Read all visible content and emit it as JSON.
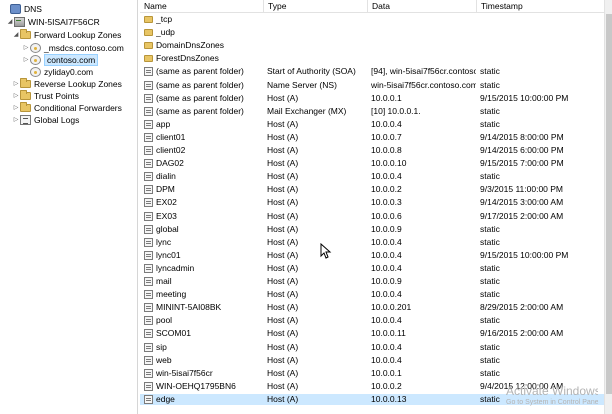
{
  "tree": {
    "items": [
      {
        "label": "DNS",
        "icon": "dns-icon",
        "expander": ""
      },
      {
        "label": "WIN-5ISAI7F56CR",
        "icon": "server-icon",
        "expander": "◢"
      },
      {
        "label": "Forward Lookup Zones",
        "icon": "folder-icon",
        "expander": "◢"
      },
      {
        "label": "_msdcs.contoso.com",
        "icon": "zone-icon",
        "expander": "▷"
      },
      {
        "label": "contoso.com",
        "icon": "zone-icon",
        "expander": "▷",
        "selected": true
      },
      {
        "label": "zyliday0.com",
        "icon": "zone-icon",
        "expander": ""
      },
      {
        "label": "Reverse Lookup Zones",
        "icon": "folder-icon",
        "expander": "▷"
      },
      {
        "label": "Trust Points",
        "icon": "folder-icon",
        "expander": "▷"
      },
      {
        "label": "Conditional Forwarders",
        "icon": "folder-icon",
        "expander": "▷"
      },
      {
        "label": "Global Logs",
        "icon": "log-icon",
        "expander": "▷"
      }
    ]
  },
  "list": {
    "columns": [
      "Name",
      "Type",
      "Data",
      "Timestamp"
    ],
    "rows": [
      {
        "name": "_tcp",
        "type": "",
        "data": "",
        "ts": "",
        "kind": "folder"
      },
      {
        "name": "_udp",
        "type": "",
        "data": "",
        "ts": "",
        "kind": "folder"
      },
      {
        "name": "DomainDnsZones",
        "type": "",
        "data": "",
        "ts": "",
        "kind": "folder"
      },
      {
        "name": "ForestDnsZones",
        "type": "",
        "data": "",
        "ts": "",
        "kind": "folder"
      },
      {
        "name": "(same as parent folder)",
        "type": "Start of Authority (SOA)",
        "data": "[94], win-5isai7f56cr.contoso....",
        "ts": "static",
        "kind": "record"
      },
      {
        "name": "(same as parent folder)",
        "type": "Name Server (NS)",
        "data": "win-5isai7f56cr.contoso.com...",
        "ts": "static",
        "kind": "record"
      },
      {
        "name": "(same as parent folder)",
        "type": "Host (A)",
        "data": "10.0.0.1",
        "ts": "9/15/2015 10:00:00 PM",
        "kind": "record"
      },
      {
        "name": "(same as parent folder)",
        "type": "Mail Exchanger (MX)",
        "data": "[10]  10.0.0.1.",
        "ts": "static",
        "kind": "record"
      },
      {
        "name": "app",
        "type": "Host (A)",
        "data": "10.0.0.4",
        "ts": "static",
        "kind": "record"
      },
      {
        "name": "client01",
        "type": "Host (A)",
        "data": "10.0.0.7",
        "ts": "9/14/2015 8:00:00 PM",
        "kind": "record"
      },
      {
        "name": "client02",
        "type": "Host (A)",
        "data": "10.0.0.8",
        "ts": "9/14/2015 6:00:00 PM",
        "kind": "record"
      },
      {
        "name": "DAG02",
        "type": "Host (A)",
        "data": "10.0.0.10",
        "ts": "9/15/2015 7:00:00 PM",
        "kind": "record"
      },
      {
        "name": "dialin",
        "type": "Host (A)",
        "data": "10.0.0.4",
        "ts": "static",
        "kind": "record"
      },
      {
        "name": "DPM",
        "type": "Host (A)",
        "data": "10.0.0.2",
        "ts": "9/3/2015 11:00:00 PM",
        "kind": "record"
      },
      {
        "name": "EX02",
        "type": "Host (A)",
        "data": "10.0.0.3",
        "ts": "9/14/2015 3:00:00 AM",
        "kind": "record"
      },
      {
        "name": "EX03",
        "type": "Host (A)",
        "data": "10.0.0.6",
        "ts": "9/17/2015 2:00:00 AM",
        "kind": "record"
      },
      {
        "name": "global",
        "type": "Host (A)",
        "data": "10.0.0.9",
        "ts": "static",
        "kind": "record"
      },
      {
        "name": "lync",
        "type": "Host (A)",
        "data": "10.0.0.4",
        "ts": "static",
        "kind": "record"
      },
      {
        "name": "lync01",
        "type": "Host (A)",
        "data": "10.0.0.4",
        "ts": "9/15/2015 10:00:00 PM",
        "kind": "record"
      },
      {
        "name": "lyncadmin",
        "type": "Host (A)",
        "data": "10.0.0.4",
        "ts": "static",
        "kind": "record"
      },
      {
        "name": "mail",
        "type": "Host (A)",
        "data": "10.0.0.9",
        "ts": "static",
        "kind": "record"
      },
      {
        "name": "meeting",
        "type": "Host (A)",
        "data": "10.0.0.4",
        "ts": "static",
        "kind": "record"
      },
      {
        "name": "MININT-5AI08BK",
        "type": "Host (A)",
        "data": "10.0.0.201",
        "ts": "8/29/2015 2:00:00 AM",
        "kind": "record"
      },
      {
        "name": "pool",
        "type": "Host (A)",
        "data": "10.0.0.4",
        "ts": "static",
        "kind": "record"
      },
      {
        "name": "SCOM01",
        "type": "Host (A)",
        "data": "10.0.0.11",
        "ts": "9/16/2015 2:00:00 AM",
        "kind": "record"
      },
      {
        "name": "sip",
        "type": "Host (A)",
        "data": "10.0.0.4",
        "ts": "static",
        "kind": "record"
      },
      {
        "name": "web",
        "type": "Host (A)",
        "data": "10.0.0.4",
        "ts": "static",
        "kind": "record"
      },
      {
        "name": "win-5isai7f56cr",
        "type": "Host (A)",
        "data": "10.0.0.1",
        "ts": "static",
        "kind": "record"
      },
      {
        "name": "WIN-OEHQ1795BN6",
        "type": "Host (A)",
        "data": "10.0.0.2",
        "ts": "9/4/2015 12:00:00 AM",
        "kind": "record"
      },
      {
        "name": "edge",
        "type": "Host (A)",
        "data": "10.0.0.13",
        "ts": "static",
        "kind": "record",
        "selected": true
      }
    ]
  },
  "watermark": {
    "title": "Activate Windows",
    "subtitle": "Go to System in Control Panel to activate Windows."
  },
  "colors": {
    "selection": "#cce8ff",
    "folder": "#e8c564",
    "watermark": "#b3b3b3"
  }
}
